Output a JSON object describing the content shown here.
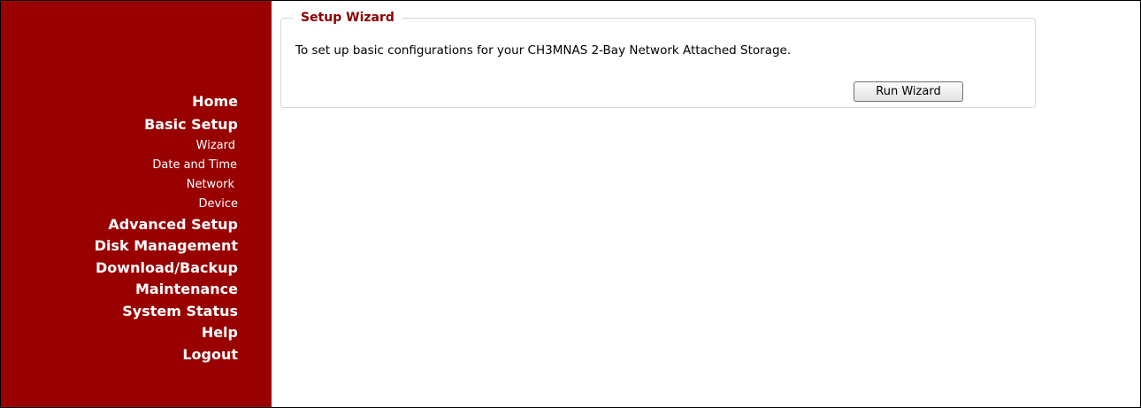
{
  "sidebar": {
    "items": [
      {
        "label": "Home"
      },
      {
        "label": "Basic Setup"
      },
      {
        "label": "Wizard"
      },
      {
        "label": "Date and Time"
      },
      {
        "label": "Network"
      },
      {
        "label": "Device"
      },
      {
        "label": "Advanced Setup"
      },
      {
        "label": "Disk Management"
      },
      {
        "label": "Download/Backup"
      },
      {
        "label": "Maintenance"
      },
      {
        "label": "System Status"
      },
      {
        "label": "Help"
      },
      {
        "label": "Logout"
      }
    ]
  },
  "main": {
    "section_title": "Setup Wizard",
    "description": "To set up basic configurations for your CH3MNAS 2-Bay Network Attached Storage.",
    "run_button_label": "Run Wizard"
  },
  "colors": {
    "sidebar_bg": "#990000",
    "legend_text": "#8b0000"
  }
}
